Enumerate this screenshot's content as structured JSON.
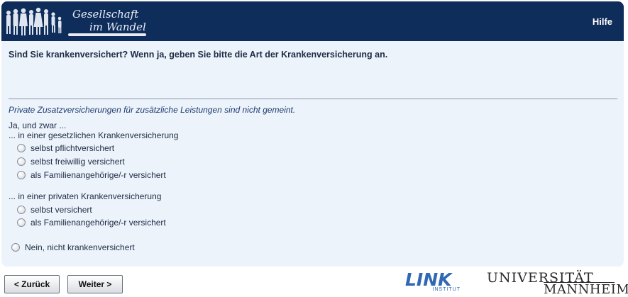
{
  "header": {
    "brand_line1": "Gesellschaft",
    "brand_line2": "im Wandel",
    "help_label": "Hilfe",
    "bg_color": "#0f2d5a"
  },
  "question": {
    "text": "Sind Sie krankenversichert? Wenn ja, geben Sie bitte die Art der Krankenversicherung an.",
    "note": "Private Zusatzversicherungen für zusätzliche Leistungen sind nicht gemeint.",
    "intro": "Ja, und zwar ...",
    "group_public_label": "... in einer gesetzlichen Krankenversicherung",
    "group_public_options": [
      "selbst pflichtversichert",
      "selbst freiwillig versichert",
      "als Familienangehörige/-r versichert"
    ],
    "group_private_label": "... in einer privaten Krankenversicherung",
    "group_private_options": [
      "selbst versichert",
      "als Familienangehörige/-r versichert"
    ],
    "option_none": "Nein, nicht krankenversichert"
  },
  "nav": {
    "back_label": "< Zurück",
    "next_label": "Weiter >"
  },
  "logos": {
    "link_word": "LINK",
    "link_sub": "INSTITUT",
    "uni_line1": "UNIVERSITÄT",
    "uni_line2": "MANNHEIM"
  }
}
